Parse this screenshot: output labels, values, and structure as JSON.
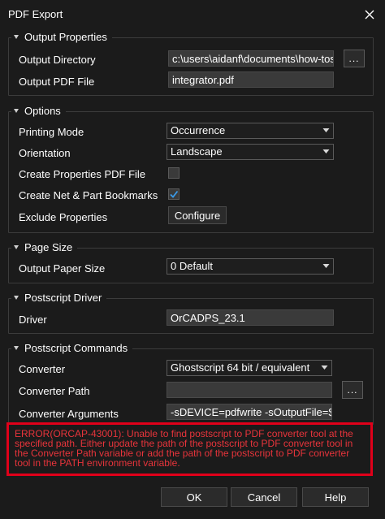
{
  "window": {
    "title": "PDF Export",
    "close_icon": "close-icon"
  },
  "output_properties": {
    "title": "Output Properties",
    "output_directory_label": "Output Directory",
    "output_directory_value": "c:\\users\\aidanf\\documents\\how-tos\\li",
    "browse_label": "...",
    "output_pdf_file_label": "Output PDF File",
    "output_pdf_file_value": "integrator.pdf"
  },
  "options": {
    "title": "Options",
    "printing_mode_label": "Printing Mode",
    "printing_mode_value": "Occurrence",
    "orientation_label": "Orientation",
    "orientation_value": "Landscape",
    "create_properties_label": "Create Properties PDF File",
    "create_properties_checked": false,
    "create_bookmarks_label": "Create Net & Part Bookmarks",
    "create_bookmarks_checked": true,
    "exclude_properties_label": "Exclude Properties",
    "configure_label": "Configure"
  },
  "page_size": {
    "title": "Page Size",
    "output_paper_size_label": "Output Paper Size",
    "output_paper_size_value": "0 Default"
  },
  "postscript_driver": {
    "title": "Postscript Driver",
    "driver_label": "Driver",
    "driver_value": "OrCADPS_23.1"
  },
  "postscript_commands": {
    "title": "Postscript Commands",
    "converter_label": "Converter",
    "converter_value": "Ghostscript 64 bit / equivalent",
    "converter_path_label": "Converter Path",
    "converter_path_value": "",
    "browse_label": "...",
    "converter_arguments_label": "Converter Arguments",
    "converter_arguments_value": "-sDEVICE=pdfwrite -sOutputFile=$::ca"
  },
  "error": {
    "message": "ERROR(ORCAP-43001): Unable to find postscript to PDF converter tool at the specified path. Either update the path of the postscript to PDF converter tool in the Converter Path variable or add the path of the postscript to PDF converter tool in the PATH environment variable.",
    "color": "#e0001a"
  },
  "buttons": {
    "ok": "OK",
    "cancel": "Cancel",
    "help": "Help"
  },
  "colors": {
    "background": "#1b1b1b",
    "field": "#3a3a3a",
    "checkmark": "#3b9be8"
  }
}
